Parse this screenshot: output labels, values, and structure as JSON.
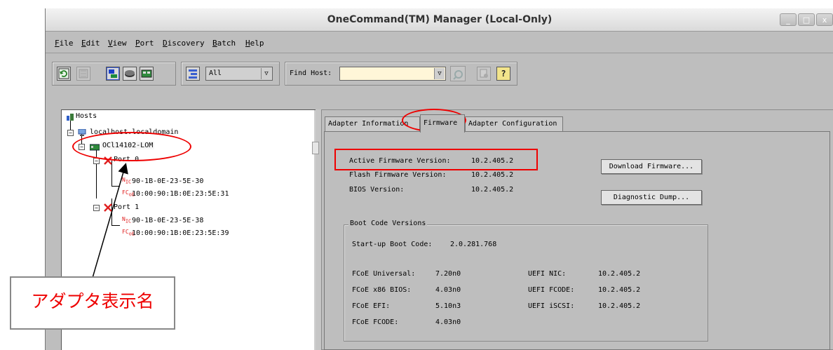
{
  "window": {
    "title": "OneCommand(TM) Manager (Local-Only)",
    "controls": [
      "_",
      "□",
      "x"
    ]
  },
  "menu": [
    {
      "label": "File",
      "mnemonic": "F"
    },
    {
      "label": "Edit",
      "mnemonic": "E"
    },
    {
      "label": "View",
      "mnemonic": "V"
    },
    {
      "label": "Port",
      "mnemonic": "P"
    },
    {
      "label": "Discovery",
      "mnemonic": "D"
    },
    {
      "label": "Batch",
      "mnemonic": "B"
    },
    {
      "label": "Help",
      "mnemonic": "H"
    }
  ],
  "toolbar": {
    "view_filter_value": "All",
    "find_host_label": "Find Host:",
    "find_host_value": "",
    "help_glyph": "?"
  },
  "tree": {
    "root": "Hosts",
    "host": "localhost.localdomain",
    "adapter": "OCl14102-LOM",
    "port0": {
      "label": "Port 0",
      "nic": "90-1B-0E-23-5E-30",
      "fcoe": "10:00:90:1B:0E:23:5E:31",
      "nic_badge": "N",
      "nic_badge_sub": "IC",
      "fcoe_badge": "FC",
      "fcoe_badge_sub": "oE"
    },
    "port1": {
      "label": "Port 1",
      "nic": "90-1B-0E-23-5E-38",
      "fcoe": "10:00:90:1B:0E:23:5E:39",
      "nic_badge": "N",
      "nic_badge_sub": "IC",
      "fcoe_badge": "FC",
      "fcoe_badge_sub": "oE"
    }
  },
  "tabs": [
    "Adapter Information",
    "Firmware",
    "Adapter Configuration"
  ],
  "firmware": {
    "active_label": "Active Firmware Version:",
    "active_value": "10.2.405.2",
    "flash_label": "Flash Firmware Version:",
    "flash_value": "10.2.405.2",
    "bios_label": "BIOS Version:",
    "bios_value": "10.2.405.2",
    "download_button": "Download Firmware...",
    "diagnostic_button": "Diagnostic Dump..."
  },
  "boot": {
    "title": "Boot Code Versions",
    "startup_label": "Start-up Boot Code:",
    "startup_value": "2.0.281.768",
    "left": [
      {
        "label": "FCoE Universal:",
        "value": "7.20n0"
      },
      {
        "label": "FCoE x86 BIOS:",
        "value": "4.03n0"
      },
      {
        "label": "FCoE EFI:",
        "value": "5.10n3"
      },
      {
        "label": "FCoE FCODE:",
        "value": "4.03n0"
      }
    ],
    "right": [
      {
        "label": "UEFI NIC:",
        "value": "10.2.405.2"
      },
      {
        "label": "UEFI FCODE:",
        "value": "10.2.405.2"
      },
      {
        "label": "UEFI iSCSI:",
        "value": "10.2.405.2"
      }
    ]
  },
  "annotation": {
    "callout_text": "アダプタ表示名",
    "highlight_color": "#e00000"
  }
}
